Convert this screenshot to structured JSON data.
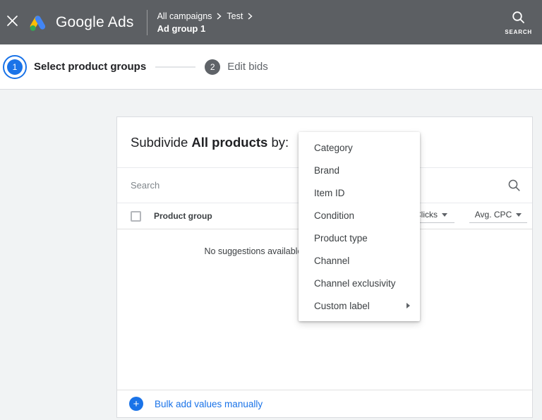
{
  "header": {
    "product_name": "Google Ads",
    "breadcrumb": {
      "level1": "All campaigns",
      "level2": "Test",
      "current": "Ad group 1"
    },
    "search_label": "SEARCH"
  },
  "stepper": {
    "steps": [
      {
        "number": "1",
        "label": "Select product groups",
        "state": "active"
      },
      {
        "number": "2",
        "label": "Edit bids",
        "state": "upcoming"
      }
    ]
  },
  "card": {
    "title_prefix": "Subdivide",
    "title_subject": "All products",
    "title_suffix": "by:",
    "search_placeholder": "Search",
    "columns": {
      "product_group": "Product group",
      "clicks": "Clicks",
      "avg_cpc": "Avg. CPC"
    },
    "empty_message": "No suggestions available. Add values manually.",
    "bulk_add_label": "Bulk add values manually"
  },
  "menu": {
    "items": [
      {
        "label": "Category"
      },
      {
        "label": "Brand"
      },
      {
        "label": "Item ID"
      },
      {
        "label": "Condition"
      },
      {
        "label": "Product type"
      },
      {
        "label": "Channel"
      },
      {
        "label": "Channel exclusivity"
      },
      {
        "label": "Custom label",
        "has_submenu": true
      }
    ]
  },
  "icons": {
    "plus": "+"
  },
  "colors": {
    "accent_blue": "#1a73e8",
    "header_bg": "#5c5f63",
    "page_bg": "#f1f3f4",
    "text_primary": "#202124",
    "text_secondary": "#5f6368",
    "border": "#dadce0",
    "logo_yellow": "#fbbc04",
    "logo_blue": "#4285f4",
    "logo_green": "#34a853"
  }
}
